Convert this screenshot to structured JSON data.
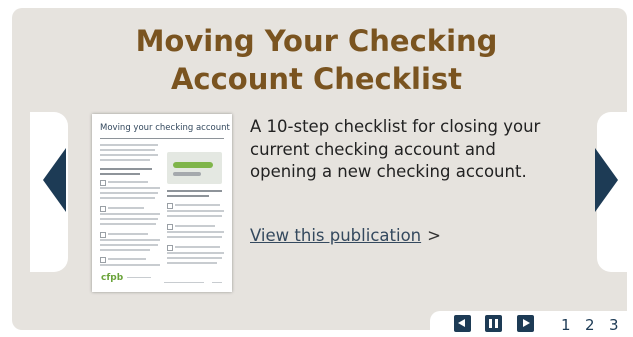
{
  "panel": {
    "title_line1": "Moving Your Checking",
    "title_line2": "Account Checklist",
    "description": "A 10-step checklist for closing your current checking account and opening a new checking account.",
    "link_label": "View this publication",
    "link_arrow": ">"
  },
  "thumbnail": {
    "doc_title": "Moving your checking account",
    "logo_text": "cfpb"
  },
  "navigation": {
    "prev_icon": "chevron-left-icon",
    "next_icon": "chevron-right-icon"
  },
  "controls": {
    "prev_icon": "skip-back-icon",
    "pause_icon": "pause-icon",
    "next_icon": "skip-forward-icon",
    "pages": [
      "1",
      "2",
      "3"
    ]
  },
  "colors": {
    "title": "#7a5420",
    "accent": "#1d3b55",
    "panel_bg": "#e6e3de"
  }
}
